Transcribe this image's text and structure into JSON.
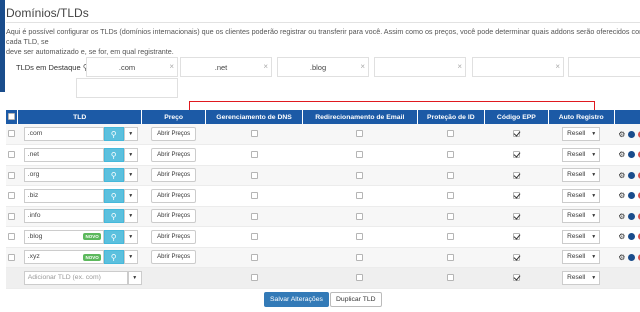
{
  "page": {
    "title": "Domínios/TLDs",
    "description_line1": "Aqui é possível configurar os TLDs (domínios internacionais) que os clientes poderão registrar ou transferir para você. Assim como os preços, você pode determinar quais addons serão oferecidos com cada TLD, se",
    "description_line2": "deve ser automatizado e, se for, em qual registrante."
  },
  "featured": {
    "label": "TLDs em Destaque",
    "slots": [
      ".com",
      ".net",
      ".blog",
      "",
      "",
      "",
      ""
    ],
    "clear_icon": "×"
  },
  "table": {
    "headers": {
      "tld": "TLD",
      "price": "Preço",
      "dns": "Gerenciamento de DNS",
      "email": "Redirecionamento de Email",
      "id": "Proteção de ID",
      "epp": "Código EPP",
      "auto": "Auto Registro"
    },
    "price_button": "Abrir Preços",
    "registrar_default": "Resell",
    "rows": [
      {
        "tld": ".com",
        "new": false,
        "dns": false,
        "email": false,
        "id": false,
        "epp": true
      },
      {
        "tld": ".net",
        "new": false,
        "dns": false,
        "email": false,
        "id": false,
        "epp": true
      },
      {
        "tld": ".org",
        "new": false,
        "dns": false,
        "email": false,
        "id": false,
        "epp": true
      },
      {
        "tld": ".biz",
        "new": false,
        "dns": false,
        "email": false,
        "id": false,
        "epp": true
      },
      {
        "tld": ".info",
        "new": false,
        "dns": false,
        "email": false,
        "id": false,
        "epp": true
      },
      {
        "tld": ".blog",
        "new": true,
        "dns": false,
        "email": false,
        "id": false,
        "epp": true
      },
      {
        "tld": ".xyz",
        "new": true,
        "dns": false,
        "email": false,
        "id": false,
        "epp": true
      }
    ],
    "new_badge": "NOVO",
    "add_placeholder": "Adicionar TLD (ex. com)"
  },
  "actions": {
    "save": "Salvar Alterações",
    "duplicate": "Duplicar TLD"
  },
  "colors": {
    "header_bg": "#1c5aa6",
    "highlight_border": "#e0191f",
    "info_button": "#5bc0de",
    "new_badge": "#5cb85c",
    "delete": "#d9534f"
  },
  "icons": {
    "bulb": "lightbulb-icon",
    "gear": "gear-icon",
    "move": "arrows-icon",
    "delete": "minus-circle-icon",
    "dropdown": "caret-down-icon"
  }
}
